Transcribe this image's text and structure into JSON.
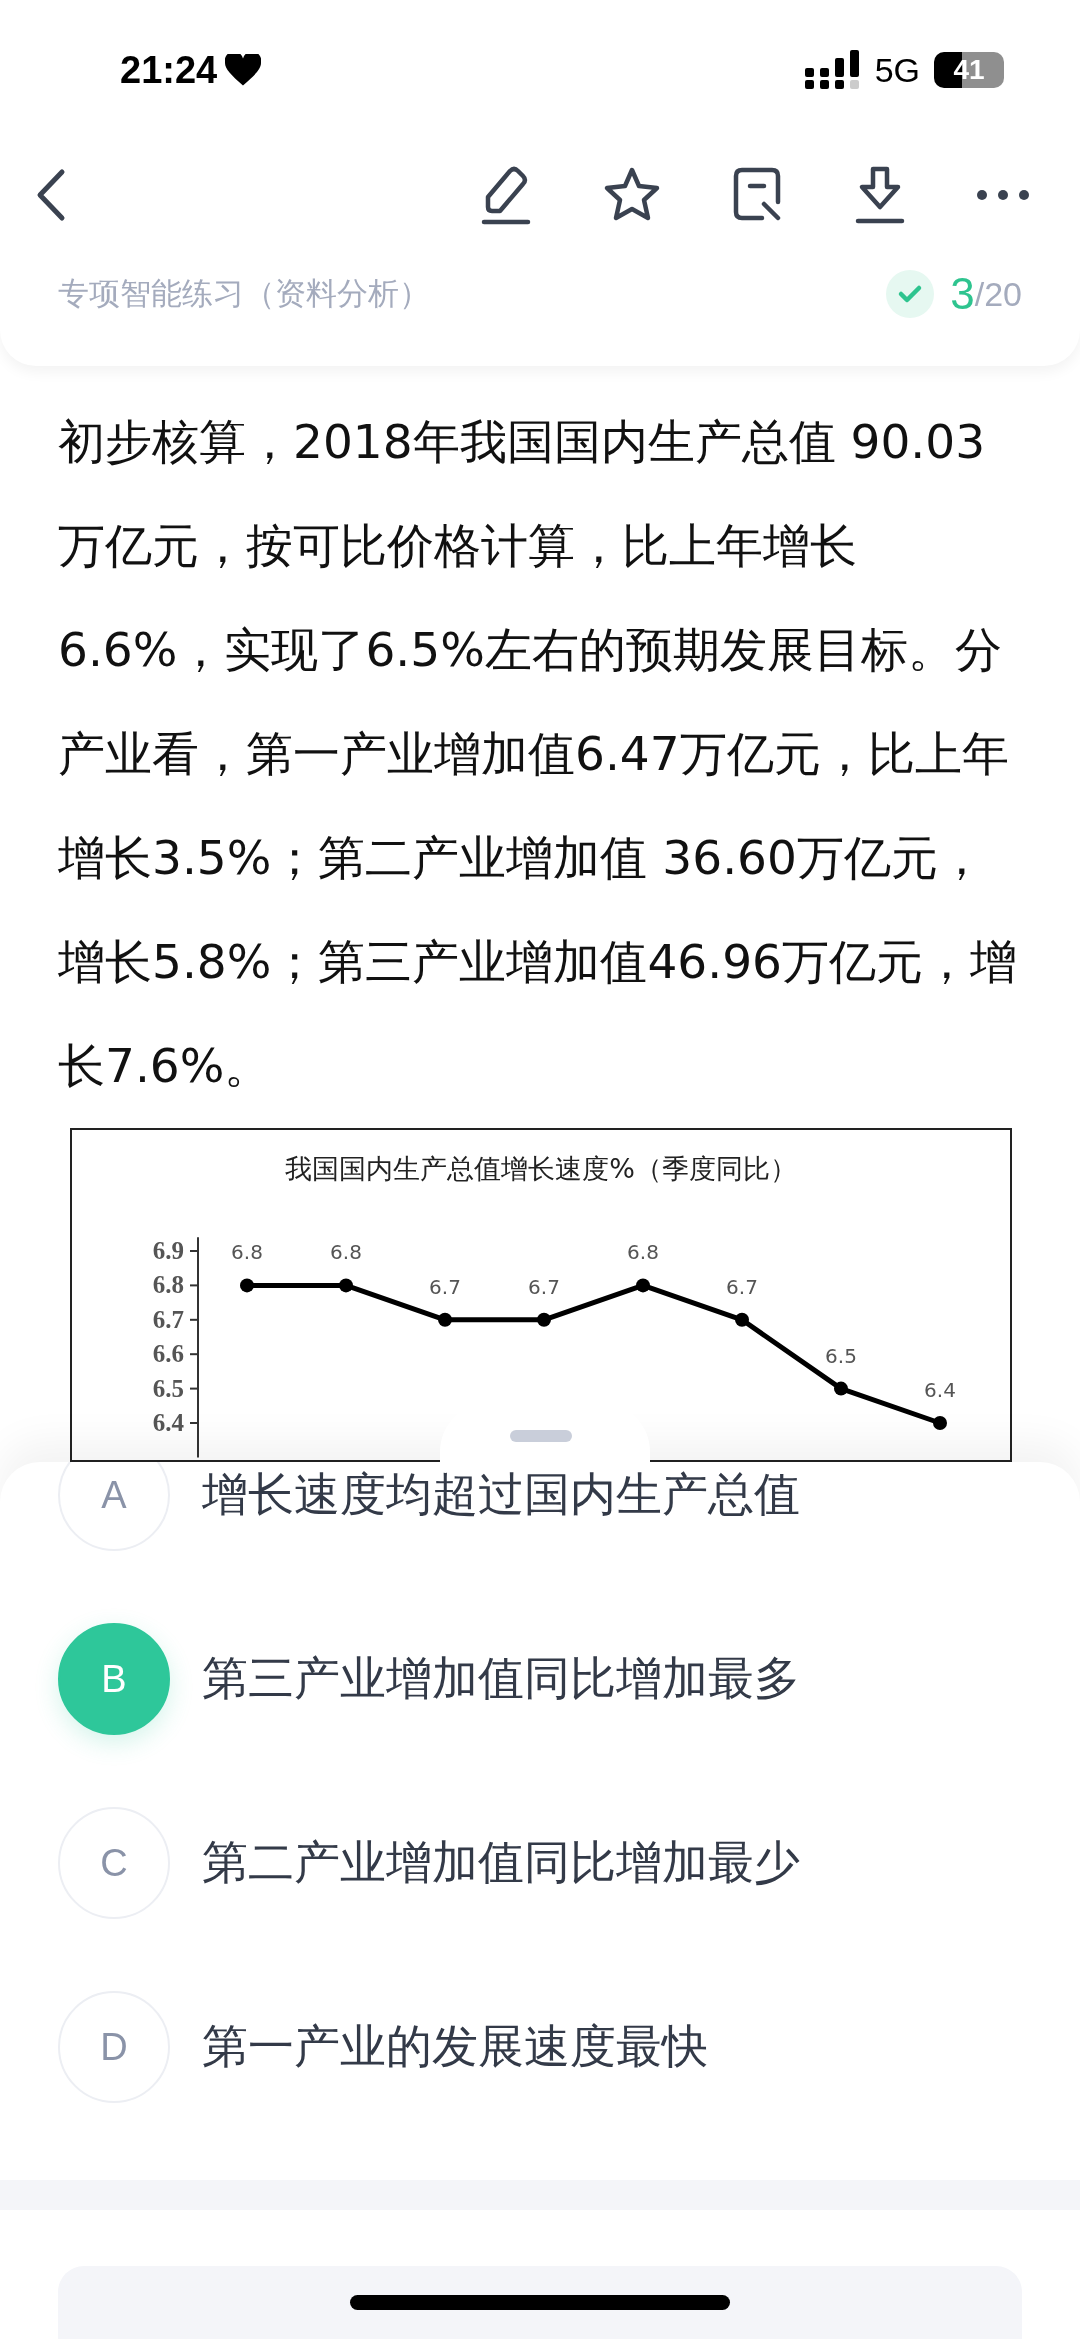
{
  "status_bar": {
    "time": "21:24",
    "network": "5G",
    "battery": "41"
  },
  "header": {
    "subtitle": "专项智能练习（资料分析）",
    "answered": true,
    "progress_current": "3",
    "progress_total": "/20"
  },
  "passage": "初步核算，2018年我国国内生产总值 90.03万亿元，按可比价格计算，比上年增长6.6%，实现了6.5%左右的预期发展目标。分产业看，第一产业增加值6.47万亿元，比上年增长3.5%；第二产业增加值 36.60万亿元，增长5.8%；第三产业增加值46.96万亿元，增长7.6%。",
  "chart": {
    "chart_data": {
      "type": "line",
      "title": "我国国内生产总值增长速度%（季度同比）",
      "categories": [
        null,
        null,
        null,
        null,
        null,
        null,
        null,
        null
      ],
      "series": [
        {
          "color": "#000000",
          "marker": "o",
          "values": [
            6.8,
            6.8,
            6.7,
            6.7,
            6.8,
            6.7,
            6.5,
            6.4
          ]
        }
      ],
      "yticks": [
        6.4,
        6.5,
        6.6,
        6.7,
        6.8,
        6.9
      ],
      "ylim": [
        6.3,
        6.94
      ],
      "data_labels": true
    }
  },
  "options": [
    {
      "letter": "A",
      "text": "增长速度均超过国内生产总值",
      "selected": false
    },
    {
      "letter": "B",
      "text": "第三产业增加值同比增加最多",
      "selected": true
    },
    {
      "letter": "C",
      "text": "第二产业增加值同比增加最少",
      "selected": false
    },
    {
      "letter": "D",
      "text": "第一产业的发展速度最快",
      "selected": false
    }
  ],
  "answer_card": {
    "kind": "card"
  }
}
